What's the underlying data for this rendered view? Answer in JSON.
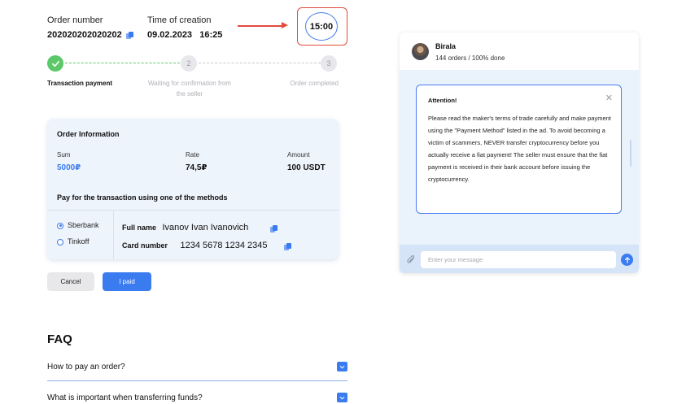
{
  "order": {
    "number_label": "Order number",
    "number_value": "202020202020202",
    "time_label": "Time of creation",
    "time_value": "09.02.2023   16:25",
    "timer": "15:00"
  },
  "steps": [
    {
      "num": "",
      "label": "Transaction payment",
      "state": "done"
    },
    {
      "num": "2",
      "label": "Waiting for confirmation from the seller",
      "state": "pending"
    },
    {
      "num": "3",
      "label": "Order completed",
      "state": "pending"
    }
  ],
  "card": {
    "title": "Order Information",
    "sum_label": "Sum",
    "sum_value": "5000₽",
    "rate_label": "Rate",
    "rate_value": "74,5₽",
    "amount_label": "Amount",
    "amount_value": "100 USDT",
    "methods_title": "Pay for the transaction using one of the methods",
    "methods": [
      {
        "label": "Sberbank",
        "selected": true
      },
      {
        "label": "Tinkoff",
        "selected": false
      }
    ],
    "fullname_label": "Full name",
    "fullname_value": "Ivanov Ivan Ivanovich",
    "card_label": "Card number",
    "card_value": "1234 5678 1234 2345"
  },
  "buttons": {
    "cancel": "Cancel",
    "paid": "I paid"
  },
  "faq": {
    "title": "FAQ",
    "items": [
      "How to pay an order?",
      "What is important when transferring funds?"
    ]
  },
  "chat": {
    "name": "Birala",
    "stats": "144 orders / 100% done",
    "attention_title": "Attention!",
    "attention_text": "Please read the maker's terms of trade carefully and make payment using the \"Payment Method\" listed in the ad. To avoid becoming a victim of scammers, NEVER transfer cryptocurrency before you actually receive a fiat payment! The seller must ensure that the fiat payment is received in their bank account before issuing the cryptocurrency.",
    "input_placeholder": "Enter your message"
  },
  "colors": {
    "accent": "#3a7bf0",
    "success": "#5cc86a",
    "highlight": "#e14b3b",
    "card_bg": "#eef4fc"
  }
}
